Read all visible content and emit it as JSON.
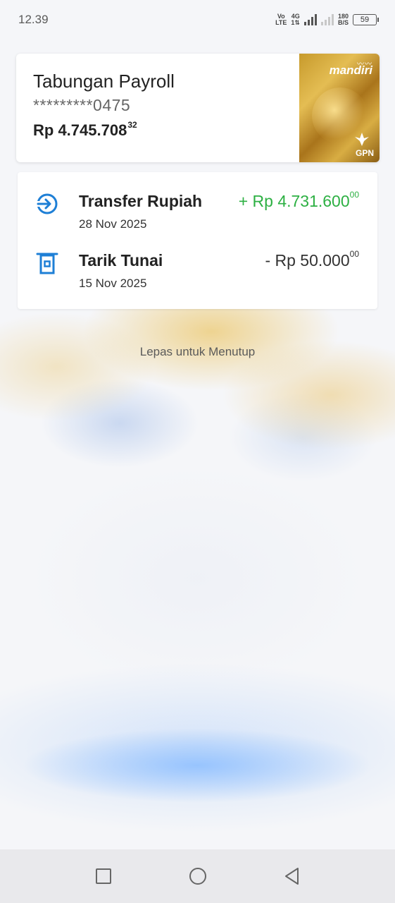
{
  "status_bar": {
    "time": "12.39",
    "network_top": "Vo",
    "network_bottom": "LTE",
    "gen_top": "4G",
    "gen_bottom": "1⇅",
    "speed_top": "180",
    "speed_bottom": "B/S",
    "battery": "59"
  },
  "account": {
    "name": "Tabungan Payroll",
    "number": "*********0475",
    "balance_main": "Rp 4.745.708",
    "balance_cents": "32",
    "card": {
      "brand": "mandiri",
      "network": "GPN"
    }
  },
  "transactions": [
    {
      "title": "Transfer Rupiah",
      "date": "28 Nov 2025",
      "amount_main": "+ Rp 4.731.600",
      "amount_cents": "00",
      "type": "credit",
      "icon": "transfer-in-icon"
    },
    {
      "title": "Tarik Tunai",
      "date": "15 Nov 2025",
      "amount_main": "- Rp 50.000",
      "amount_cents": "00",
      "type": "debit",
      "icon": "atm-withdrawal-icon"
    }
  ],
  "hint": "Lepas untuk Menutup",
  "colors": {
    "credit": "#2db043",
    "icon_blue": "#1e7fd6"
  },
  "nav": {
    "recents_icon": "square-icon",
    "home_icon": "circle-icon",
    "back_icon": "triangle-back-icon"
  }
}
